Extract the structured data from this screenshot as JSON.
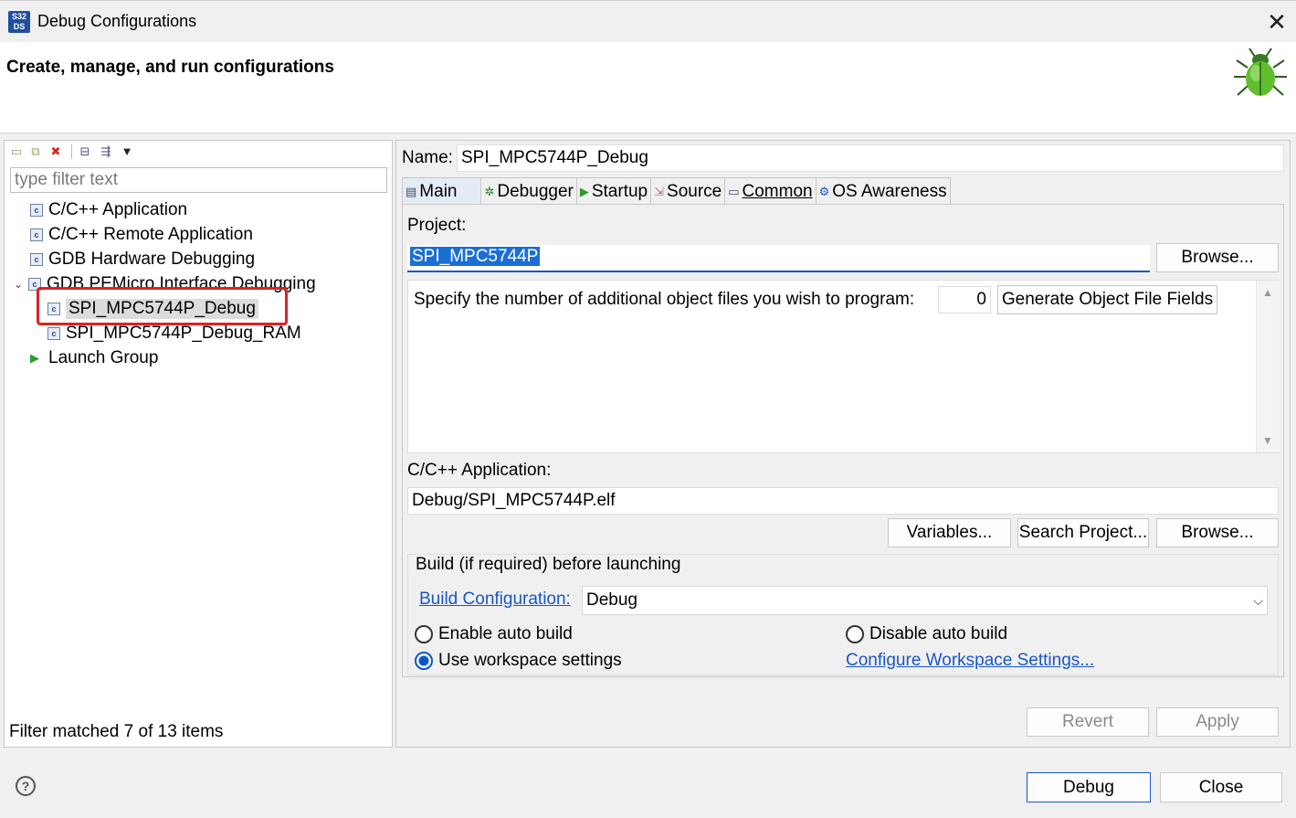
{
  "window": {
    "title": "Debug Configurations",
    "close_glyph": "✕",
    "app_icon_text": "S32 DS"
  },
  "header": {
    "title": "Create, manage, and run configurations",
    "banner_icon": "bug-icon"
  },
  "left": {
    "filter_placeholder": "type filter text",
    "tree": [
      {
        "label": "C/C++ Application",
        "level": 0
      },
      {
        "label": "C/C++ Remote Application",
        "level": 0
      },
      {
        "label": "GDB Hardware Debugging",
        "level": 0
      },
      {
        "label": "GDB PEMicro Interface Debugging",
        "level": 0,
        "expanded": true
      },
      {
        "label": "SPI_MPC5744P_Debug",
        "level": 1,
        "selected": true
      },
      {
        "label": "SPI_MPC5744P_Debug_RAM",
        "level": 1
      },
      {
        "label": "Launch Group",
        "level": 0
      }
    ],
    "status": "Filter matched 7 of 13 items"
  },
  "right": {
    "name_label": "Name:",
    "name_value": "SPI_MPC5744P_Debug",
    "tabs": [
      "Main",
      "Debugger",
      "Startup",
      "Source",
      "Common",
      "OS Awareness"
    ],
    "active_tab": "Main",
    "project_label": "Project:",
    "project_value": "SPI_MPC5744P",
    "browse_label": "Browse...",
    "object_files_label": "Specify the number of additional object files you wish to program:",
    "object_files_value": "0",
    "generate_label": "Generate Object File Fields",
    "app_label": "C/C++ Application:",
    "app_value": "Debug/SPI_MPC5744P.elf",
    "variables_label": "Variables...",
    "search_project_label": "Search Project...",
    "browse2_label": "Browse...",
    "build_group_label": "Build (if required) before launching",
    "build_config_label": "Build Configuration:",
    "build_config_value": "Debug",
    "enable_auto_build": "Enable auto build",
    "disable_auto_build": "Disable auto build",
    "use_workspace": "Use workspace settings",
    "configure_workspace": "Configure Workspace Settings...",
    "revert_label": "Revert",
    "apply_label": "Apply"
  },
  "footer": {
    "debug_label": "Debug",
    "close_label": "Close",
    "help_glyph": "?"
  }
}
